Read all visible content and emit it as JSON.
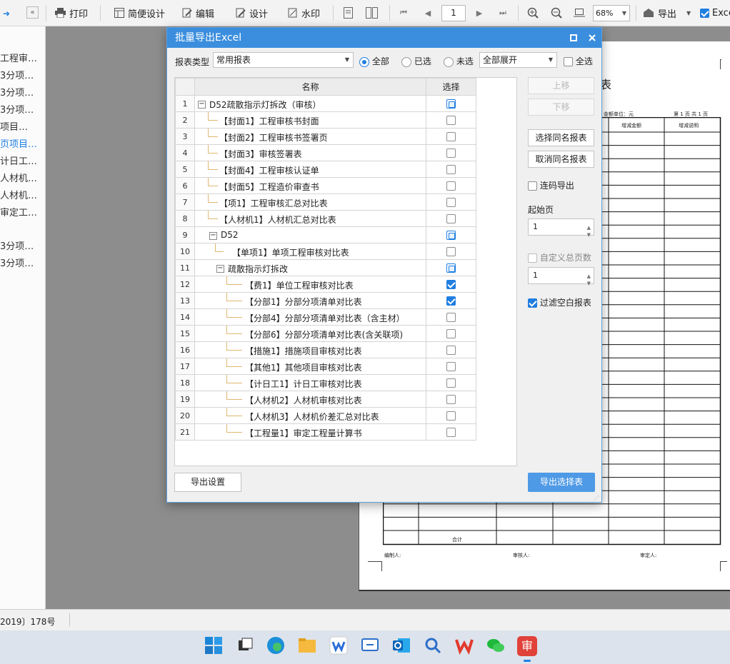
{
  "toolbar": {
    "print": "打印",
    "simple_design": "简便设计",
    "edit": "编辑",
    "design": "设计",
    "watermark": "水印",
    "page": "1",
    "zoom": "68%",
    "export": "导出",
    "excel": "Exce"
  },
  "left_panel": {
    "items": [
      "工程审…",
      "3分项…",
      "3分项…",
      "3分项…",
      "项目…",
      "页项目…",
      "计日工…",
      "人材机…",
      "人材机…",
      "审定工…",
      "3分项…",
      "3分项…"
    ],
    "active_index": 5
  },
  "status_bar": {
    "text": "2019〕178号"
  },
  "doc_preview": {
    "title_char": "表",
    "unit": "金额单位：元",
    "page": "第 1 页  共 1 页",
    "col_increase": "增减金额",
    "col_note": "增减说明",
    "total": "合计",
    "compiler": "编制人:",
    "reviewer": "审核人:",
    "approver": "审定人:"
  },
  "dialog": {
    "title": "批量导出Excel",
    "report_type_label": "报表类型",
    "report_type_value": "常用报表",
    "radio_all": "全部",
    "radio_selected": "已选",
    "radio_unselected": "未选",
    "expand_value": "全部展开",
    "select_all": "全选",
    "col_name": "名称",
    "col_select": "选择",
    "rows": [
      {
        "num": "1",
        "name": "D52疏散指示灯拆改（审核）",
        "level": 0,
        "toggle": "−",
        "state": "part"
      },
      {
        "num": "2",
        "name": "【封面1】工程审核书封面",
        "level": 1,
        "state": "off"
      },
      {
        "num": "3",
        "name": "【封面2】工程审核书签署页",
        "level": 1,
        "state": "off"
      },
      {
        "num": "4",
        "name": "【封面3】审核签署表",
        "level": 1,
        "state": "off"
      },
      {
        "num": "5",
        "name": "【封面4】工程审核认证单",
        "level": 1,
        "state": "off"
      },
      {
        "num": "6",
        "name": "【封面5】工程造价审查书",
        "level": 1,
        "state": "off"
      },
      {
        "num": "7",
        "name": "【项1】工程审核汇总对比表",
        "level": 1,
        "state": "off"
      },
      {
        "num": "8",
        "name": "【人材机1】人材机汇总对比表",
        "level": 1,
        "state": "off"
      },
      {
        "num": "9",
        "name": "D52",
        "level": 1,
        "toggle": "−",
        "state": "part"
      },
      {
        "num": "10",
        "name": "【单项1】单项工程审核对比表",
        "level": 2,
        "state": "off"
      },
      {
        "num": "11",
        "name": "疏散指示灯拆改",
        "level": 2,
        "toggle": "−",
        "state": "part"
      },
      {
        "num": "12",
        "name": "【费1】单位工程审核对比表",
        "level": 3,
        "state": "on"
      },
      {
        "num": "13",
        "name": "【分部1】分部分项清单对比表",
        "level": 3,
        "state": "on"
      },
      {
        "num": "14",
        "name": "【分部4】分部分项清单对比表（含主材）",
        "level": 3,
        "state": "off"
      },
      {
        "num": "15",
        "name": "【分部6】分部分项清单对比表(含关联项)",
        "level": 3,
        "state": "off"
      },
      {
        "num": "16",
        "name": "【措施1】措施项目审核对比表",
        "level": 3,
        "state": "off"
      },
      {
        "num": "17",
        "name": "【其他1】其他项目审核对比表",
        "level": 3,
        "state": "off"
      },
      {
        "num": "18",
        "name": "【计日工1】计日工审核对比表",
        "level": 3,
        "state": "off"
      },
      {
        "num": "19",
        "name": "【人材机2】人材机审核对比表",
        "level": 3,
        "state": "off"
      },
      {
        "num": "20",
        "name": "【人材机3】人材机价差汇总对比表",
        "level": 3,
        "state": "off"
      },
      {
        "num": "21",
        "name": "【工程量1】审定工程量计算书",
        "level": 3,
        "state": "off"
      }
    ],
    "btn_up": "上移",
    "btn_down": "下移",
    "btn_select_same": "选择同名报表",
    "btn_cancel_same": "取消同名报表",
    "continuous_export": "连码导出",
    "start_page_label": "起始页",
    "start_page_value": "1",
    "custom_total_label": "自定义总页数",
    "custom_total_value": "1",
    "filter_blank": "过滤空白报表",
    "export_settings": "导出设置",
    "export_selected": "导出选择表",
    "accent_color": "#3b8ede"
  },
  "taskbar": {
    "icons": [
      "windows-start-icon",
      "task-view-icon",
      "edge-icon",
      "file-explorer-icon",
      "wps-office-icon",
      "remote-desktop-icon",
      "outlook-icon",
      "search-icon",
      "wps-icon",
      "wechat-icon",
      "audit-app-icon"
    ],
    "audit_label": "审"
  }
}
